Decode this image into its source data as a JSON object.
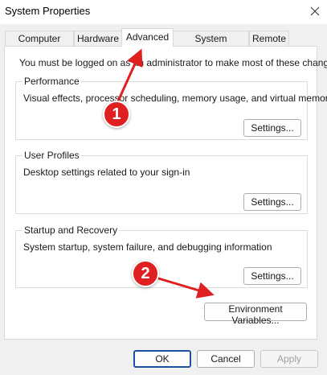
{
  "window": {
    "title": "System Properties"
  },
  "tabs": [
    {
      "label": "Computer Name",
      "active": false
    },
    {
      "label": "Hardware",
      "active": false
    },
    {
      "label": "Advanced",
      "active": true
    },
    {
      "label": "System Protection",
      "active": false
    },
    {
      "label": "Remote",
      "active": false
    }
  ],
  "advanced": {
    "admin_notice": "You must be logged on as an administrator to make most of these changes.",
    "performance": {
      "label": "Performance",
      "description": "Visual effects, processor scheduling, memory usage, and virtual memory",
      "button": "Settings..."
    },
    "user_profiles": {
      "label": "User Profiles",
      "description": "Desktop settings related to your sign-in",
      "button": "Settings..."
    },
    "startup_recovery": {
      "label": "Startup and Recovery",
      "description": "System startup, system failure, and debugging information",
      "button": "Settings..."
    },
    "environment_button": "Environment Variables..."
  },
  "footer": {
    "ok": "OK",
    "cancel": "Cancel",
    "apply": "Apply"
  },
  "annotations": [
    {
      "number": "1"
    },
    {
      "number": "2"
    }
  ],
  "colors": {
    "annotation_red": "#e02020",
    "focus_border": "#1f4fa0"
  },
  "icons": {
    "close": "close-icon"
  }
}
